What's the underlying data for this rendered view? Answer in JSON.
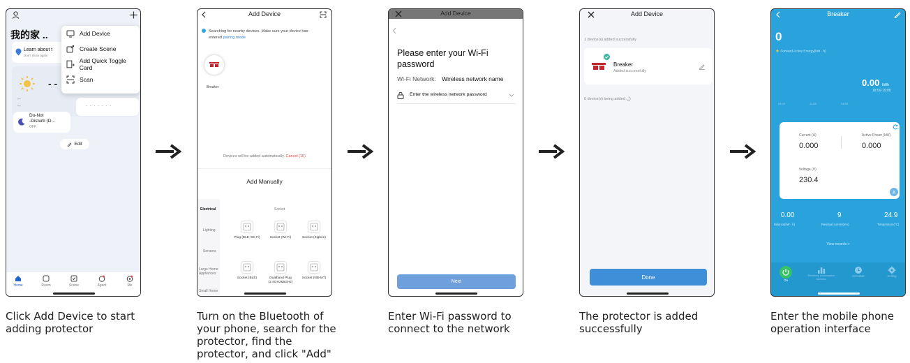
{
  "phone1": {
    "title": "我的家 ..",
    "menu": {
      "add_device": "Add Device",
      "create_scene": "Create Scene",
      "add_quick_toggle_card": "Add Quick Toggle Card",
      "scan": "Scan"
    },
    "learn_about": "Learn about t",
    "dont_show": "Don't show again",
    "weather_dashes": "- -",
    "weather_dashes2": "--",
    "weather_dashes3": "--",
    "placeholder_dashes": "- - - - - - -",
    "dnd_label_1": "Do-Not",
    "dnd_label_2": "-Disturb (D...",
    "dnd_state": "OFF",
    "edit": "Edit",
    "tabs": [
      "Home",
      "Room",
      "Scene",
      "Agent",
      "Me"
    ]
  },
  "phone2": {
    "title": "Add Device",
    "searching": "Searching for nearby devices. Make sure your device has",
    "entered": "entered",
    "pairing_mode": "pairing mode",
    "device_name": "Breaker",
    "auto_add": "Devices will be added automatically.",
    "cancel": "Cancel (15)",
    "add_manually": "Add Manually",
    "categories": [
      "Electrical",
      "Lighting",
      "Sensors",
      "Large Home Appliances",
      "Small Home"
    ],
    "socket_header": "Socket",
    "sockets": [
      {
        "name": "Plug (BLE+Wi-Fi)"
      },
      {
        "name": "Socket (Wi-Fi)"
      },
      {
        "name": "Socket (Zigbee)"
      },
      {
        "name": "Socket (BLE)"
      },
      {
        "name": "Dualband Plug (2.4GHz&5GHz)"
      },
      {
        "name": "Socket (NB-IoT)"
      }
    ]
  },
  "phone3": {
    "title": "Add Device",
    "heading_1": "Please enter your Wi-Fi",
    "heading_2": "password",
    "network_label": "Wi-Fi Network:",
    "network_name": "Wireless network name",
    "password_placeholder": "Enter the wireless network password",
    "next": "Next"
  },
  "phone4": {
    "title": "Add Device",
    "added_count": "1 device(s) added successfully",
    "device_name": "Breaker",
    "device_status": "Added successfully",
    "being_added": "0 device(s) being added",
    "done": "Done"
  },
  "phone5": {
    "title": "Breaker",
    "energy_value": "0",
    "energy_label": "Forward Active Energy(kW · h)",
    "current_value": "0.00",
    "current_unit": "kWh",
    "time_range": "18:00-19:00",
    "time_ticks": [
      "01:00",
      "13:00",
      "24:00"
    ],
    "current_label": "Current (A)",
    "current_reading": "0.000",
    "power_label": "Active Power (kW)",
    "power_reading": "0.000",
    "voltage_label": "Voltage (V)",
    "voltage_reading": "230.4",
    "balance_value": "0.00",
    "balance_label": "Balance(kW · h)",
    "residual_value": "9",
    "residual_label": "Residual current(mA)",
    "temp_value": "24.9",
    "temp_label": "Temperature(°C)",
    "view_records": "View records >",
    "tabs": [
      "On",
      "Electricity consumption statistics",
      "Schedule",
      "Setting"
    ]
  },
  "captions": [
    "Click Add Device to start adding protector",
    "Turn on the Bluetooth of your phone, search for the protector, find the protector, and click \"Add\"",
    "Enter Wi-Fi password to connect to the network",
    "The protector is added successfully",
    "Enter the mobile phone operation interface"
  ],
  "colors": {
    "accent_blue": "#2aa3dc",
    "done_blue": "#3f8ed8",
    "cancel_red": "#e24b4b",
    "arrow": "#222222"
  }
}
